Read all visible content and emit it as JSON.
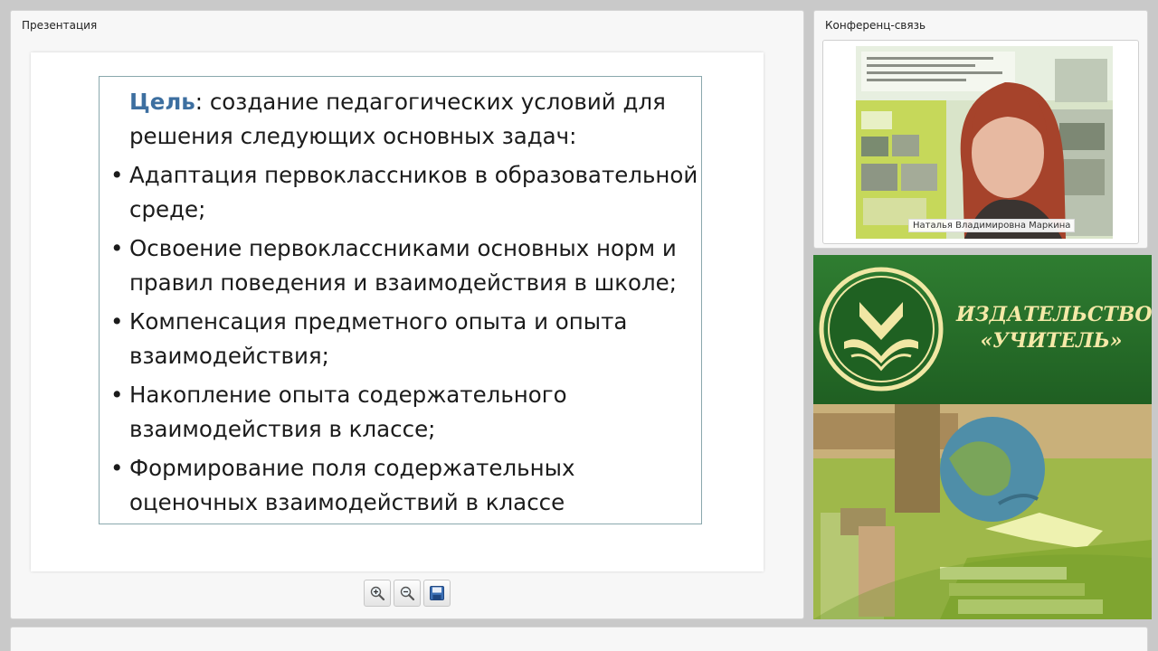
{
  "presentation": {
    "title": "Презентация",
    "slide": {
      "goal_word": "Цель",
      "goal_text": ": создание педагогических условий для решения следующих основных задач:",
      "bullet_glyph": "•",
      "bullets": [
        "Адаптация первоклассников в образовательной среде;",
        "Освоение первоклассниками основных норм и правил поведения и взаимодействия в школе;",
        "Компенсация предметного опыта и опыта взаимодействия;",
        "Накопление опыта содержательного взаимодействия в классе;",
        "Формирование поля содержательных оценочных взаимодействий в классе"
      ]
    },
    "toolbar": {
      "zoom_in_icon": "zoom-in-icon",
      "zoom_out_icon": "zoom-out-icon",
      "save_icon": "save-icon"
    }
  },
  "conference": {
    "title": "Конференц-связь",
    "participant_name": "Наталья Владимировна Маркина"
  },
  "publisher": {
    "name_line1": "ИЗДАТЕЛЬСТВО",
    "name_line2": "«УЧИТЕЛЬ»",
    "colors": {
      "green": "#2a722c",
      "gold": "#f5e9a8"
    }
  }
}
